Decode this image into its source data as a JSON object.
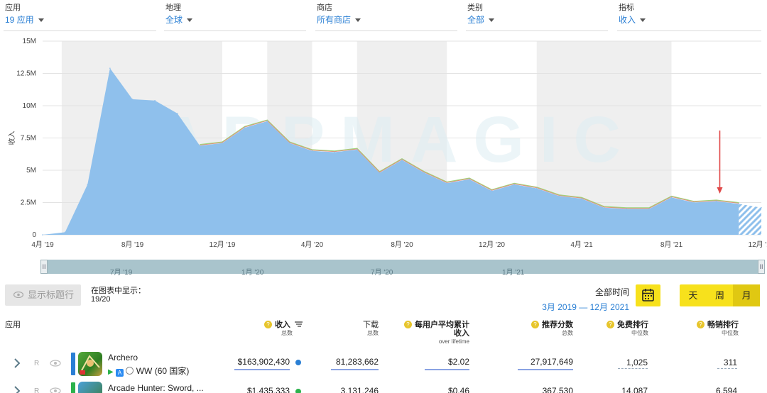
{
  "filters": [
    {
      "label": "应用",
      "value": "19 应用"
    },
    {
      "label": "地理",
      "value": "全球"
    },
    {
      "label": "商店",
      "value": "所有商店"
    },
    {
      "label": "类别",
      "value": "全部"
    },
    {
      "label": "指标",
      "value": "收入"
    }
  ],
  "colors": {
    "accent": "#2a7fd4",
    "area_fill": "#8fc0ec",
    "green_line": "#9fd47a",
    "red_line": "#e8867a",
    "arrow": "#e04848",
    "yellow": "#f7e11c"
  },
  "chart_data": {
    "type": "area",
    "watermark": "APPMAGIC",
    "ylabel": "收入",
    "ylim": [
      0,
      15000000
    ],
    "yticks": [
      "0",
      "2.5M",
      "5M",
      "7.5M",
      "10M",
      "12.5M",
      "15M"
    ],
    "xticks": [
      "4月 '19",
      "8月 '19",
      "12月 '19",
      "4月 '20",
      "8月 '20",
      "12月 '20",
      "4月 '21",
      "8月 '21",
      "12月 '21"
    ],
    "x": [
      "2019-04",
      "2019-05",
      "2019-06",
      "2019-07",
      "2019-08",
      "2019-09",
      "2019-10",
      "2019-11",
      "2019-12",
      "2020-01",
      "2020-02",
      "2020-03",
      "2020-04",
      "2020-05",
      "2020-06",
      "2020-07",
      "2020-08",
      "2020-09",
      "2020-10",
      "2020-11",
      "2020-12",
      "2021-01",
      "2021-02",
      "2021-03",
      "2021-04",
      "2021-05",
      "2021-06",
      "2021-07",
      "2021-08",
      "2021-09",
      "2021-10",
      "2021-11",
      "2021-12"
    ],
    "series": [
      {
        "values": [
          0,
          200000,
          3900000,
          12900000,
          10500000,
          10400000,
          9400000,
          6900000,
          7100000,
          8300000,
          8800000,
          7100000,
          6500000,
          6400000,
          6600000,
          4800000,
          5800000,
          4800000,
          4000000,
          4300000,
          3400000,
          3900000,
          3600000,
          3000000,
          2800000,
          2100000,
          2000000,
          2000000,
          2900000,
          2500000,
          2600000,
          2400000,
          2100000
        ]
      }
    ],
    "partial_period": [
      "2021-11",
      "2021-12"
    ],
    "annotation_arrow_at": "2021-10",
    "shaded_bands": [
      [
        "2019-04",
        "2019-12"
      ],
      [
        "2020-02",
        "2020-04"
      ],
      [
        "2020-06",
        "2020-10"
      ],
      [
        "2021-02",
        "2021-08"
      ]
    ]
  },
  "timeline": {
    "labels": [
      "7月 '19",
      "1月 '20",
      "7月 '20",
      "1月 '21"
    ],
    "handle_left": "II",
    "handle_right": "II"
  },
  "toolbar": {
    "show_titles_label": "显示标题行",
    "show_in_chart_label": "在图表中显示：",
    "show_in_chart_value": "19/20",
    "all_time_label": "全部时间",
    "date_range": "3月 2019 — 12月 2021",
    "granularity": [
      "天",
      "周",
      "月"
    ],
    "granularity_active": "月"
  },
  "table": {
    "headers": [
      {
        "title": "应用",
        "sub": ""
      },
      {
        "title": "收入",
        "sub": "总数"
      },
      {
        "title": "下载",
        "sub": "总数"
      },
      {
        "title": "每用户平均累计",
        "title2": "收入",
        "sub": "over lifetime"
      },
      {
        "title": "推荐分数",
        "sub": "总数"
      },
      {
        "title": "免费排行",
        "sub": "中位数"
      },
      {
        "title": "畅销排行",
        "sub": "中位数"
      }
    ],
    "rows": [
      {
        "rank": "R",
        "name": "Archero",
        "geo": "WW (60 国家)",
        "revenue": "$163,902,430",
        "downloads": "81,283,662",
        "arpu": "$2.02",
        "score": "27,917,649",
        "free_rank": "1,025",
        "grossing_rank": "311",
        "dot_color": "#2a7fd4"
      },
      {
        "rank": "R",
        "name": "Arcade Hunter: Sword, ...",
        "geo": "",
        "revenue": "$1,435,333",
        "downloads": "3,131,246",
        "arpu": "$0.46",
        "score": "367,530",
        "free_rank": "14,087",
        "grossing_rank": "6,594",
        "dot_color": "#2bb24c"
      }
    ]
  }
}
